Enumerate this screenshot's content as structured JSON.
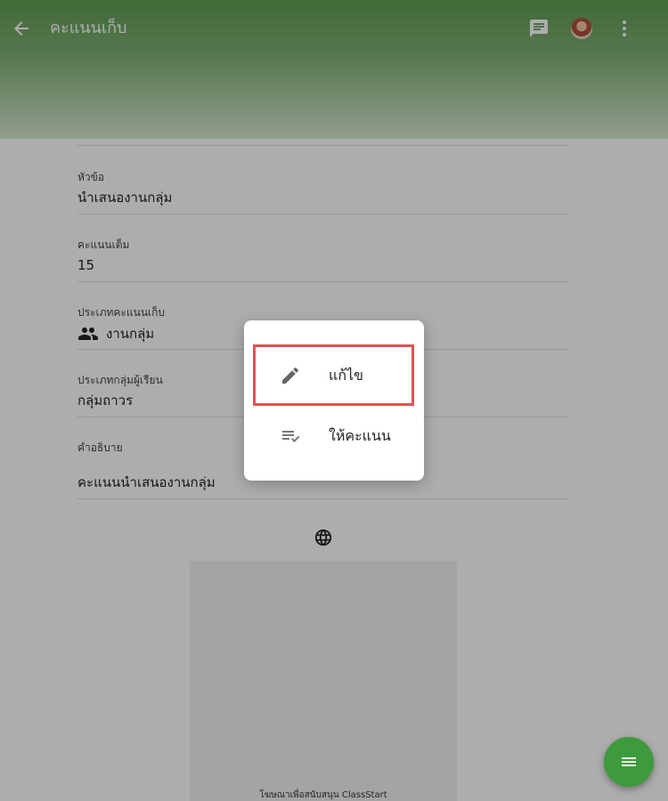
{
  "appbar": {
    "title": "คะแนนเก็บ",
    "back_icon": "arrow-back-icon",
    "chat_icon": "chat-icon",
    "avatar_icon": "user-avatar",
    "more_icon": "more-vert-icon"
  },
  "fields": [
    {
      "label": "หัวข้อ",
      "value": "นำเสนองานกลุ่ม"
    },
    {
      "label": "คะแนนเต็ม",
      "value": "15"
    },
    {
      "label": "ประเภทคะแนนเก็บ",
      "value": "งานกลุ่ม",
      "icon": "group-icon"
    },
    {
      "label": "ประเภทกลุ่มผู้เรียน",
      "value": "กลุ่มถาวร"
    },
    {
      "label": "คำอธิบาย",
      "value": "คะแนนนำเสนองานกลุ่ม"
    }
  ],
  "ad": {
    "text": "โฆษณาเพื่อสนับสนุน ClassStart",
    "icon": "globe-icon"
  },
  "menu": {
    "items": [
      {
        "label": "แก้ไข",
        "icon": "edit-icon",
        "highlighted": true
      },
      {
        "label": "ให้คะแนน",
        "icon": "grade-list-icon",
        "highlighted": false
      }
    ]
  },
  "fab": {
    "icon": "menu-icon"
  },
  "colors": {
    "appbar_top": "#5f9c52",
    "fab": "#3d9a3d",
    "highlight_border": "#e05252"
  }
}
